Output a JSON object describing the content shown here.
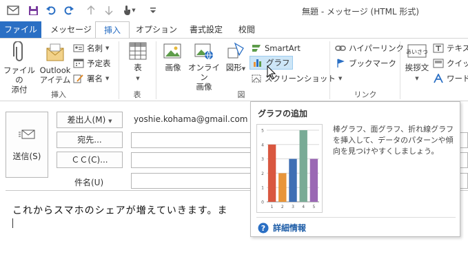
{
  "window": {
    "title": "無題 - メッセージ (HTML 形式)"
  },
  "tabs": {
    "file": "ファイル",
    "message": "メッセージ",
    "insert": "挿入",
    "options": "オプション",
    "format": "書式設定",
    "review": "校閲"
  },
  "ribbon": {
    "include": {
      "attach_file": [
        "ファイルの",
        "添付"
      ],
      "outlook_item": [
        "Outlook",
        "アイテム"
      ],
      "business_card": "名刺",
      "calendar": "予定表",
      "signature": "署名",
      "label": "挿入"
    },
    "tables": {
      "table": "表",
      "label": "表"
    },
    "illustrations": {
      "picture": "画像",
      "online_picture": [
        "オンライン",
        "画像"
      ],
      "shapes": "図形",
      "smartart": "SmartArt",
      "chart": "グラフ",
      "screenshot": "スクリーンショット",
      "label": "図"
    },
    "links": {
      "hyperlink": "ハイパーリンク",
      "bookmark": "ブックマーク",
      "label": "リンク"
    },
    "text": {
      "greeting": "挨拶文",
      "textbox": "テキスト",
      "quickparts": "クイック",
      "wordart": "ワード"
    }
  },
  "compose": {
    "send": "送信(S)",
    "from_button": "差出人(M)",
    "from_value": "yoshie.kohama@gmail.com",
    "to_button": "宛先...",
    "cc_button": "ＣＣ(C)...",
    "subject_label": "件名(U)",
    "body": "これからスマホのシェアが増えていきます。ま"
  },
  "tooltip": {
    "title": "グラフの追加",
    "description": "棒グラフ、面グラフ、折れ線グラフを挿入して、データのパターンや傾向を見つけやすくしましょう。",
    "more_info": "詳細情報"
  },
  "chart_data": {
    "type": "bar",
    "categories": [
      "1",
      "2",
      "3",
      "4",
      "5"
    ],
    "values": [
      4,
      2,
      3,
      5,
      3
    ],
    "y_ticks": [
      "0",
      "1",
      "2",
      "3",
      "4",
      "5"
    ],
    "ylim": [
      0,
      5
    ],
    "colors": [
      "#d9573f",
      "#e8953a",
      "#3f6fb4",
      "#79ab96",
      "#9a68b4"
    ],
    "grid": true
  },
  "colors": {
    "accent": "#2a6fc4",
    "highlight": "#cde6f7"
  }
}
